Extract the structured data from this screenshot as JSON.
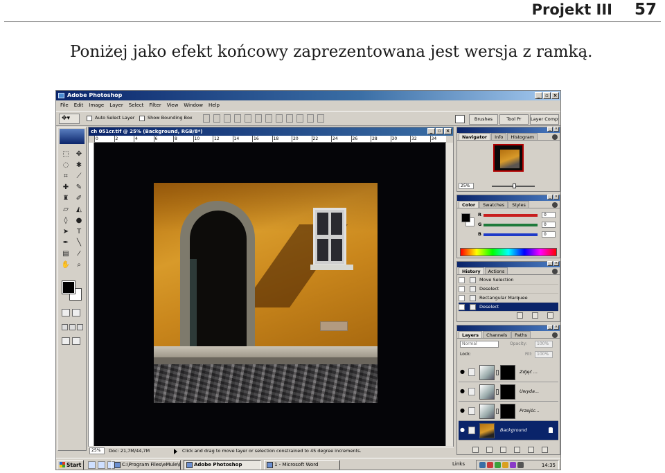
{
  "header": {
    "section_title": "Projekt III",
    "page_number": "57"
  },
  "body_text": "Poniżej jako efekt końcowy zaprezentowana jest wersja z ramką.",
  "screenshot": {
    "app_title": "Adobe Photoshop",
    "menu": [
      "File",
      "Edit",
      "Image",
      "Layer",
      "Select",
      "Filter",
      "View",
      "Window",
      "Help"
    ],
    "options_bar": {
      "auto_select_label": "Auto Select Layer",
      "bounding_box_label": "Show Bounding Box",
      "palette_well_tabs": [
        "Brushes",
        "Tool Pr",
        "Layer Comps"
      ]
    },
    "document": {
      "title": "ch 051cr.tif @ 25% (Background, RGB/8*)",
      "ruler_numbers": [
        "0",
        "2",
        "4",
        "6",
        "8",
        "10",
        "12",
        "14",
        "16",
        "18",
        "20",
        "22",
        "24",
        "26",
        "28",
        "30",
        "32",
        "34"
      ],
      "zoom": "25%",
      "doc_size": "Doc: 21,7M/44,7M",
      "status_hint": "Click and drag to move layer or selection constrained to 45 degree increments."
    },
    "navigator": {
      "tabs": [
        "Navigator",
        "Info",
        "Histogram"
      ],
      "zoom": "25%"
    },
    "color": {
      "tabs": [
        "Color",
        "Swatches",
        "Styles"
      ],
      "sliders": [
        {
          "label": "R",
          "value": "0",
          "color": "#c81e1e"
        },
        {
          "label": "G",
          "value": "0",
          "color": "#1e7a3a"
        },
        {
          "label": "B",
          "value": "0",
          "color": "#1e3ac8"
        }
      ]
    },
    "history": {
      "tabs": [
        "History",
        "Actions"
      ],
      "items": [
        "Move Selection",
        "Deselect",
        "Rectangular Marquee",
        "Deselect"
      ]
    },
    "layers": {
      "tabs": [
        "Layers",
        "Channels",
        "Paths"
      ],
      "blend_mode": "Normal",
      "opacity_label": "Opacity:",
      "opacity_value": "100%",
      "lock_label": "Lock:",
      "fill_label": "Fill:",
      "fill_value": "100%",
      "items": [
        "Zdjęć ...",
        "Uwyda...",
        "Przejśc...",
        "Background"
      ]
    },
    "taskbar": {
      "start_label": "Start",
      "tasks": [
        "C:\\Program Files\\eMule\\I...",
        "Adobe Photoshop",
        "1 - Microsoft Word"
      ],
      "links_label": "Links",
      "clock": "14:35"
    }
  }
}
